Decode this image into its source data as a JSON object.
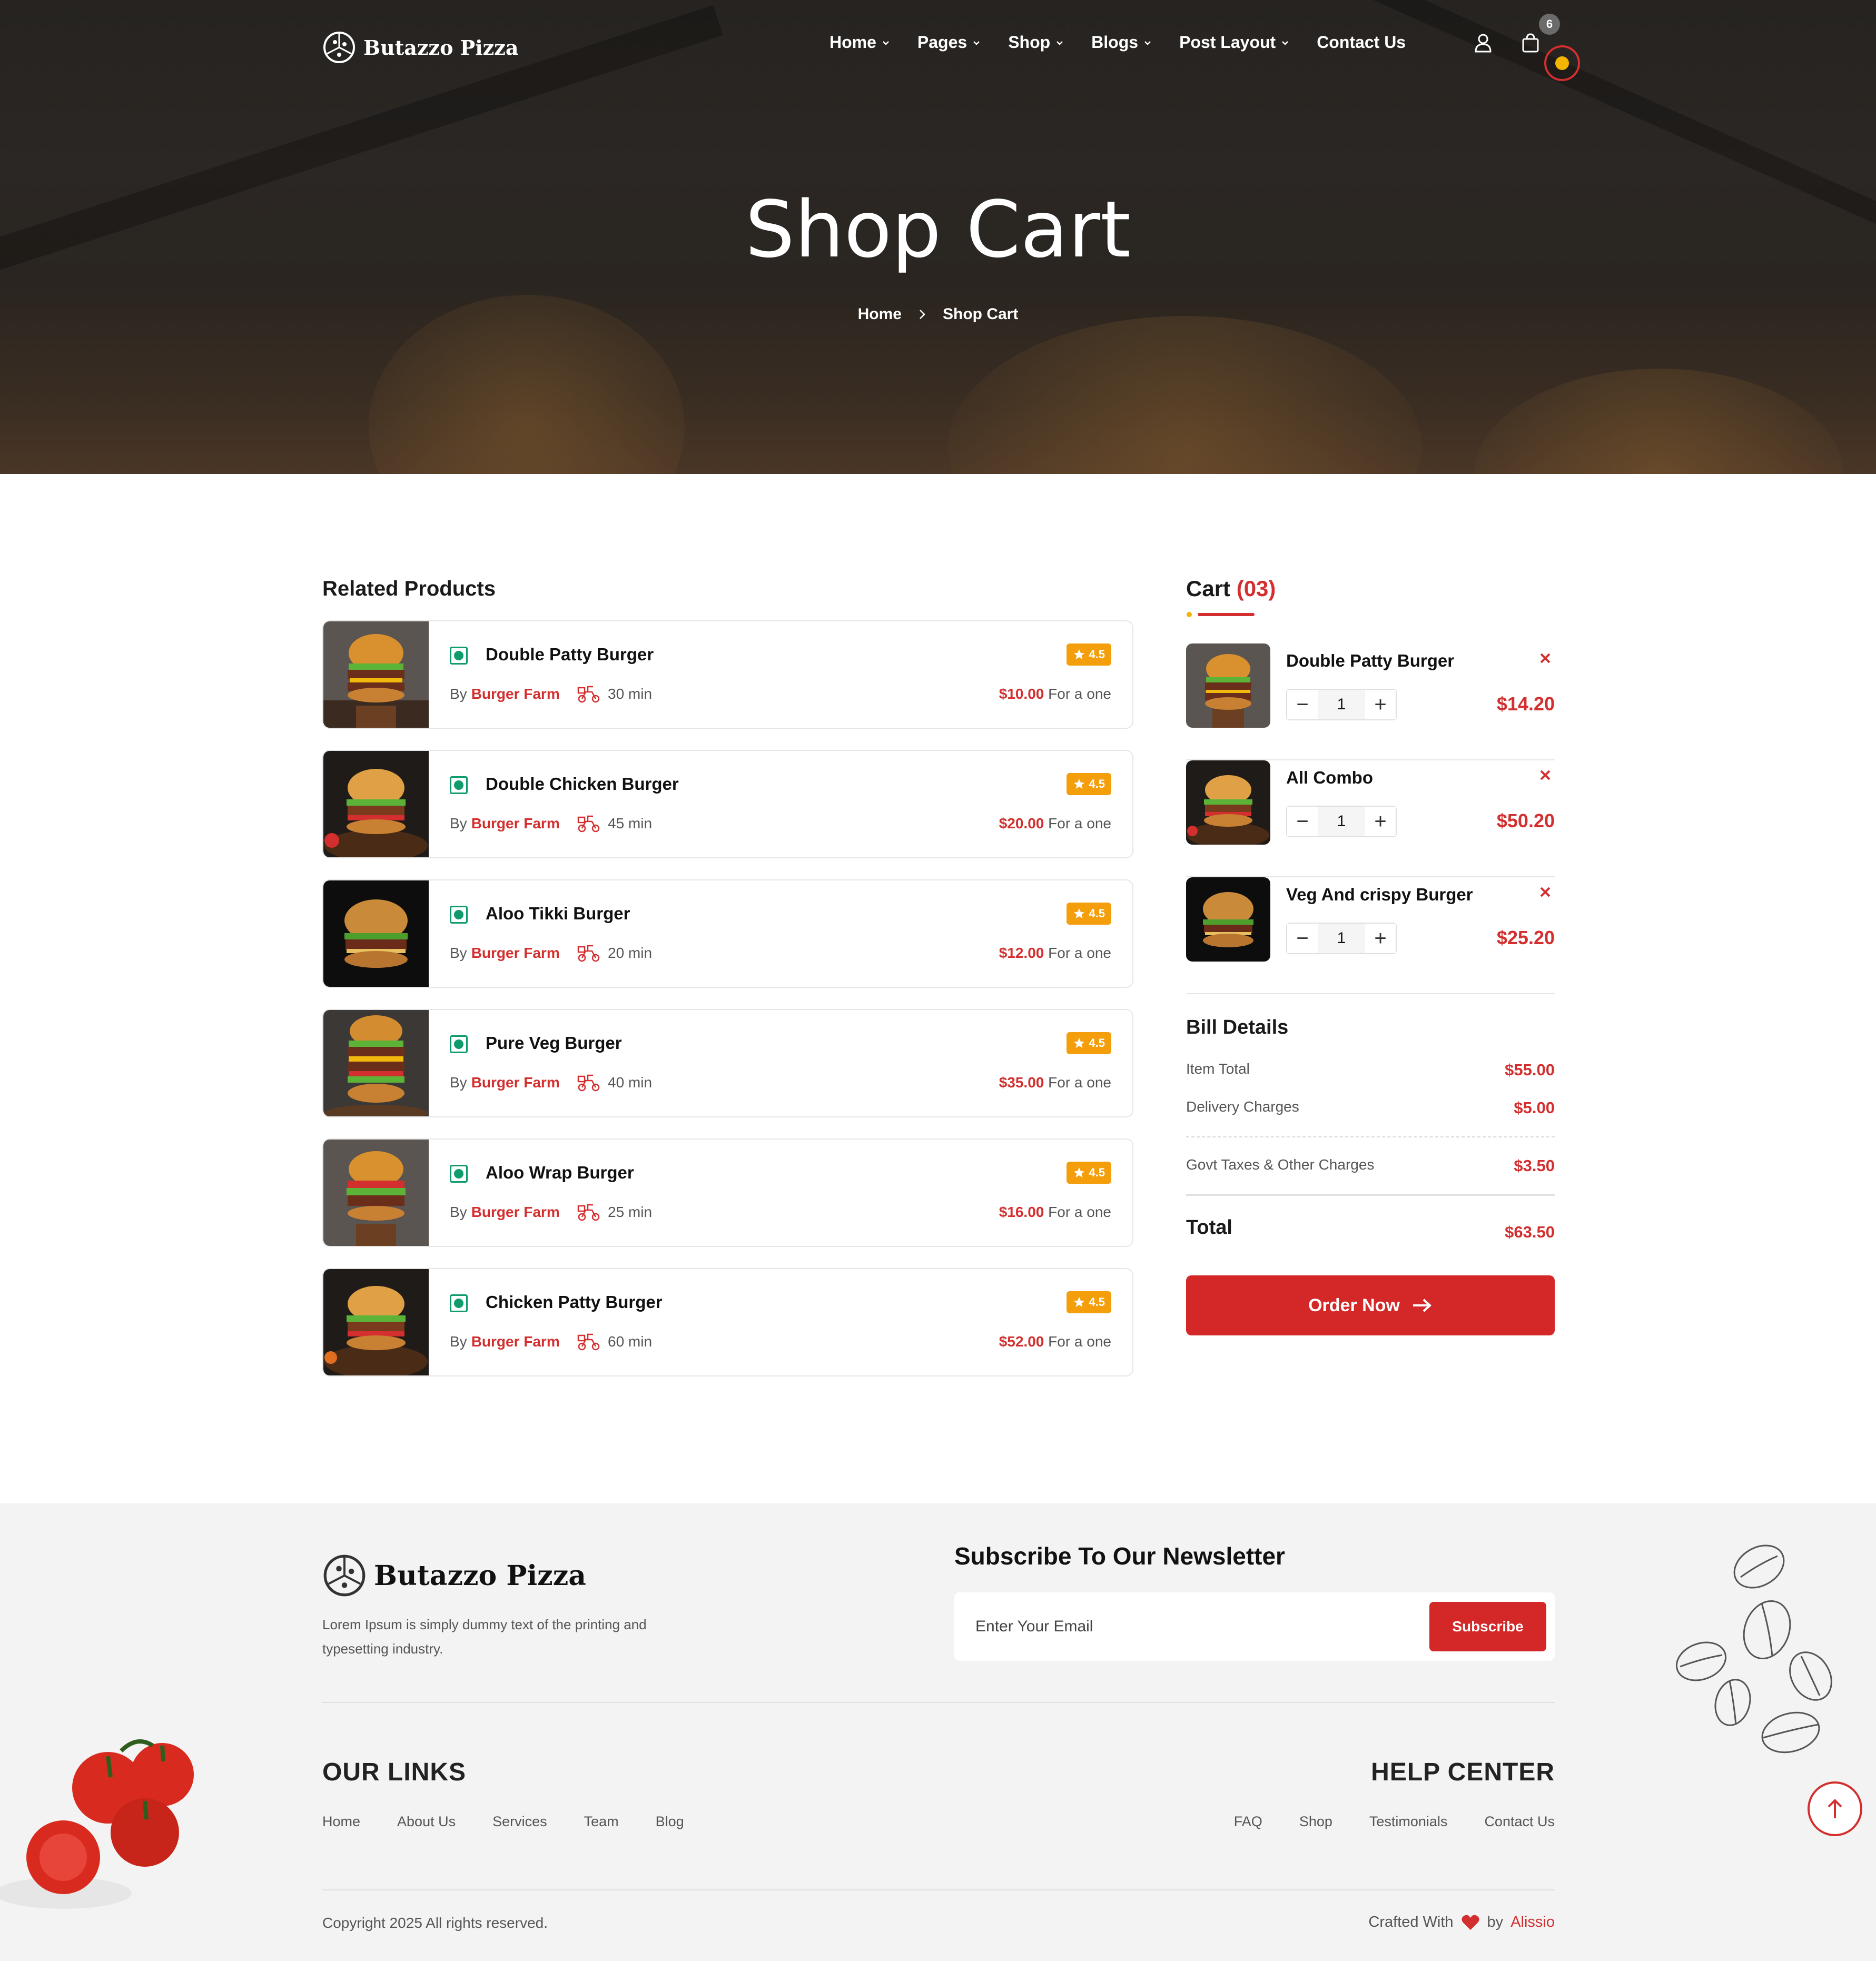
{
  "brand": {
    "name": "Butazzo Pizza",
    "footer_name": "Butazzo Pizza"
  },
  "nav": {
    "items": [
      {
        "label": "Home",
        "dropdown": true
      },
      {
        "label": "Pages",
        "dropdown": true
      },
      {
        "label": "Shop",
        "dropdown": true
      },
      {
        "label": "Blogs",
        "dropdown": true
      },
      {
        "label": "Post Layout",
        "dropdown": true
      },
      {
        "label": "Contact Us",
        "dropdown": false
      }
    ],
    "cart_count": "6"
  },
  "hero": {
    "title": "Shop Cart",
    "breadcrumb": {
      "home": "Home",
      "current": "Shop Cart"
    }
  },
  "related": {
    "title": "Related Products",
    "items": [
      {
        "name": "Double Patty Burger",
        "rating": "4.5",
        "by": "By",
        "vendor": "Burger Farm",
        "time": "30 min",
        "price": "$10.00",
        "unit": "For a one"
      },
      {
        "name": "Double Chicken Burger",
        "rating": "4.5",
        "by": "By",
        "vendor": "Burger Farm",
        "time": "45 min",
        "price": "$20.00",
        "unit": "For a one"
      },
      {
        "name": "Aloo Tikki Burger",
        "rating": "4.5",
        "by": "By",
        "vendor": "Burger Farm",
        "time": "20 min",
        "price": "$12.00",
        "unit": "For a one"
      },
      {
        "name": "Pure Veg Burger",
        "rating": "4.5",
        "by": "By",
        "vendor": "Burger Farm",
        "time": "40 min",
        "price": "$35.00",
        "unit": "For a one"
      },
      {
        "name": "Aloo Wrap Burger",
        "rating": "4.5",
        "by": "By",
        "vendor": "Burger Farm",
        "time": "25 min",
        "price": "$16.00",
        "unit": "For a one"
      },
      {
        "name": "Chicken Patty Burger",
        "rating": "4.5",
        "by": "By",
        "vendor": "Burger Farm",
        "time": "60 min",
        "price": "$52.00",
        "unit": "For a one"
      }
    ]
  },
  "cart": {
    "title": "Cart",
    "count": "(03)",
    "items": [
      {
        "name": "Double Patty Burger",
        "qty": "1",
        "price": "$14.20"
      },
      {
        "name": "All Combo",
        "qty": "1",
        "price": "$50.20"
      },
      {
        "name": "Veg And crispy Burger",
        "qty": "1",
        "price": "$25.20"
      }
    ]
  },
  "bill": {
    "title": "Bill Details",
    "item_total_label": "Item Total",
    "item_total": "$55.00",
    "delivery_label": "Delivery Charges",
    "delivery": "$5.00",
    "taxes_label": "Govt Taxes & Other Charges",
    "taxes": "$3.50",
    "total_label": "Total",
    "total": "$63.50",
    "order_button": "Order Now"
  },
  "footer": {
    "description": "Lorem Ipsum is simply dummy text of the printing and typesetting industry.",
    "newsletter_title": "Subscribe To Our Newsletter",
    "email_placeholder": "Enter Your Email",
    "subscribe_button": "Subscribe",
    "links_title": "OUR LINKS",
    "links": [
      "Home",
      "About Us",
      "Services",
      "Team",
      "Blog"
    ],
    "help_title": "HELP CENTER",
    "help_links": [
      "FAQ",
      "Shop",
      "Testimonials",
      "Contact Us"
    ],
    "copyright": "Copyright 2025 All rights reserved.",
    "crafted_prefix": "Crafted With",
    "crafted_by": "by",
    "crafted_author": "Alissio"
  },
  "colors": {
    "accent": "#d32f2f",
    "rating": "#f59e0b",
    "veg": "#0f9b6b",
    "footer_bg": "#f3f3f3"
  }
}
